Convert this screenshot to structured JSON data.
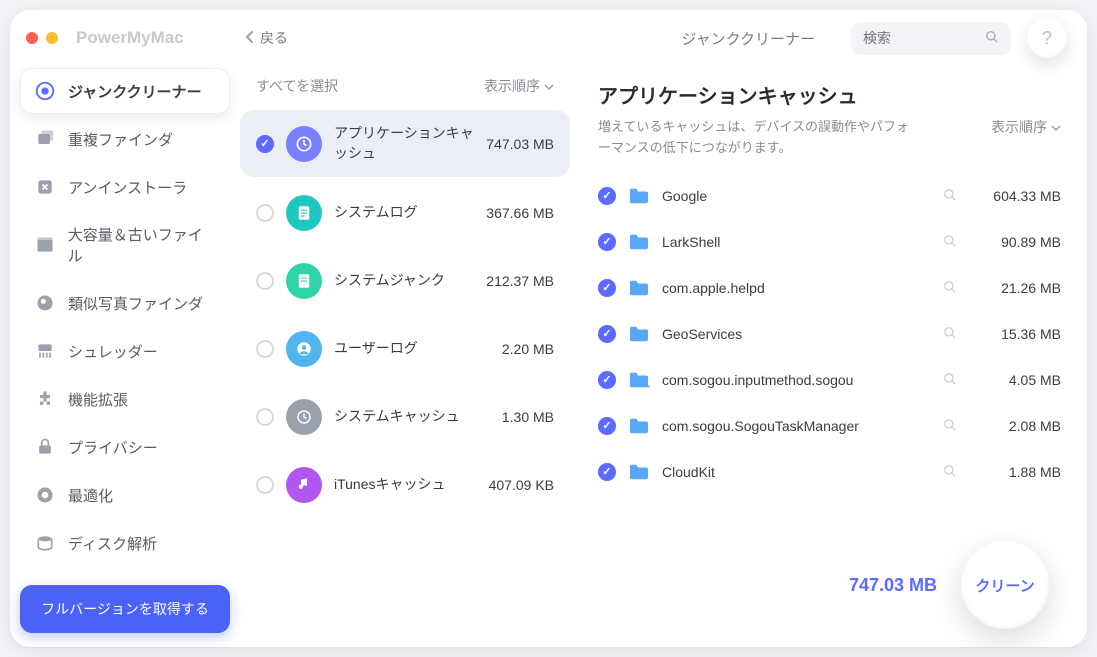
{
  "brand": "PowerMyMac",
  "back_label": "戻る",
  "top_title": "ジャンククリーナー",
  "search_placeholder": "検索",
  "help_label": "?",
  "sidebar": {
    "items": [
      {
        "label": "ジャンククリーナー",
        "icon": "junk-cleaner-icon"
      },
      {
        "label": "重複ファインダ",
        "icon": "duplicate-icon"
      },
      {
        "label": "アンインストーラ",
        "icon": "uninstaller-icon"
      },
      {
        "label": "大容量＆古いファイル",
        "icon": "large-old-icon"
      },
      {
        "label": "類似写真ファインダ",
        "icon": "similar-photo-icon"
      },
      {
        "label": "シュレッダー",
        "icon": "shredder-icon"
      },
      {
        "label": "機能拡張",
        "icon": "extensions-icon"
      },
      {
        "label": "プライバシー",
        "icon": "privacy-icon"
      },
      {
        "label": "最適化",
        "icon": "optimize-icon"
      },
      {
        "label": "ディスク解析",
        "icon": "disk-icon"
      }
    ],
    "full_version": "フルバージョンを取得する"
  },
  "mid": {
    "select_all": "すべてを選択",
    "sort_label": "表示順序",
    "categories": [
      {
        "label": "アプリケーションキャッシュ",
        "size": "747.03 MB",
        "checked": true,
        "color": "#7a7fff"
      },
      {
        "label": "システムログ",
        "size": "367.66 MB",
        "checked": false,
        "color": "#1fc7c1"
      },
      {
        "label": "システムジャンク",
        "size": "212.37 MB",
        "checked": false,
        "color": "#2dd4a8"
      },
      {
        "label": "ユーザーログ",
        "size": "2.20 MB",
        "checked": false,
        "color": "#4fb4f0"
      },
      {
        "label": "システムキャッシュ",
        "size": "1.30 MB",
        "checked": false,
        "color": "#9aa0ac"
      },
      {
        "label": "iTunesキャッシュ",
        "size": "407.09 KB",
        "checked": false,
        "color": "#b356f0"
      }
    ]
  },
  "right": {
    "title": "アプリケーションキャッシュ",
    "desc": "増えているキャッシュは、デバイスの誤動作やパフォーマンスの低下につながります。",
    "sort_label": "表示順序",
    "files": [
      {
        "name": "Google",
        "size": "604.33 MB"
      },
      {
        "name": "LarkShell",
        "size": "90.89 MB"
      },
      {
        "name": "com.apple.helpd",
        "size": "21.26 MB"
      },
      {
        "name": "GeoServices",
        "size": "15.36 MB"
      },
      {
        "name": "com.sogou.inputmethod.sogou",
        "size": "4.05 MB"
      },
      {
        "name": "com.sogou.SogouTaskManager",
        "size": "2.08 MB"
      },
      {
        "name": "CloudKit",
        "size": "1.88 MB"
      }
    ],
    "total": "747.03 MB",
    "clean_label": "クリーン"
  }
}
